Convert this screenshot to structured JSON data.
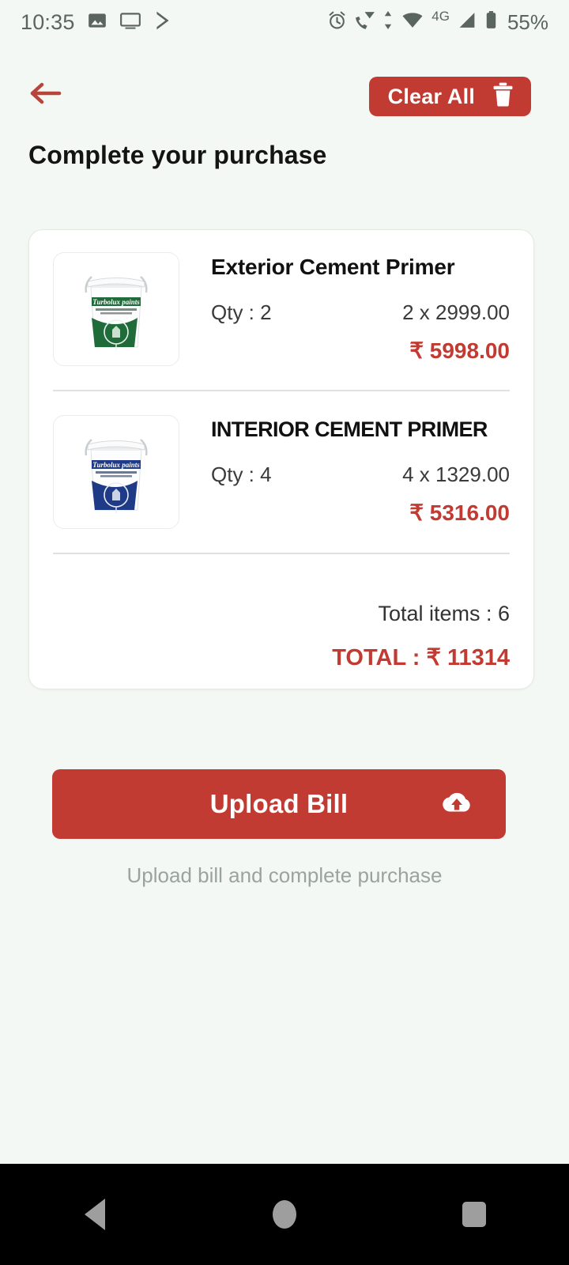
{
  "status_bar": {
    "time": "10:35",
    "battery_percent": "55%",
    "network_type": "4G",
    "left_icons": [
      "photo-icon",
      "cast-screen-icon",
      "play-store-icon"
    ],
    "right_icons": [
      "alarm-icon",
      "vowifi-call-icon",
      "data-transfer-icon",
      "wifi-icon",
      "signal-icon",
      "battery-icon"
    ]
  },
  "top_bar": {
    "back_icon": "arrow-left-icon",
    "clear_all_label": "Clear All",
    "clear_all_icon": "trash-icon"
  },
  "page": {
    "title": "Complete your purchase"
  },
  "cart": {
    "items": [
      {
        "name": "Exterior Cement Primer",
        "qty_label": "Qty : 2",
        "unit_calc": "2 x 2999.00",
        "line_total": "₹ 5998.00",
        "thumbnail": "green-paint-bucket-image"
      },
      {
        "name": "INTERIOR CEMENT PRIMER",
        "qty_label": "Qty : 4",
        "unit_calc": "4 x 1329.00",
        "line_total": "₹ 5316.00",
        "thumbnail": "blue-paint-bucket-image"
      }
    ],
    "total_items_label": "Total items : 6",
    "grand_total_label": "TOTAL : ₹ 11314"
  },
  "upload": {
    "button_label": "Upload Bill",
    "button_icon": "cloud-upload-icon",
    "hint": "Upload bill and complete purchase"
  },
  "nav_bar": {
    "back": "nav-back-icon",
    "home": "nav-home-icon",
    "recents": "nav-recents-icon"
  },
  "colors": {
    "accent_red": "#c23b32",
    "background": "#f4f8f4",
    "card": "#ffffff",
    "muted_text": "#9aa39d"
  }
}
